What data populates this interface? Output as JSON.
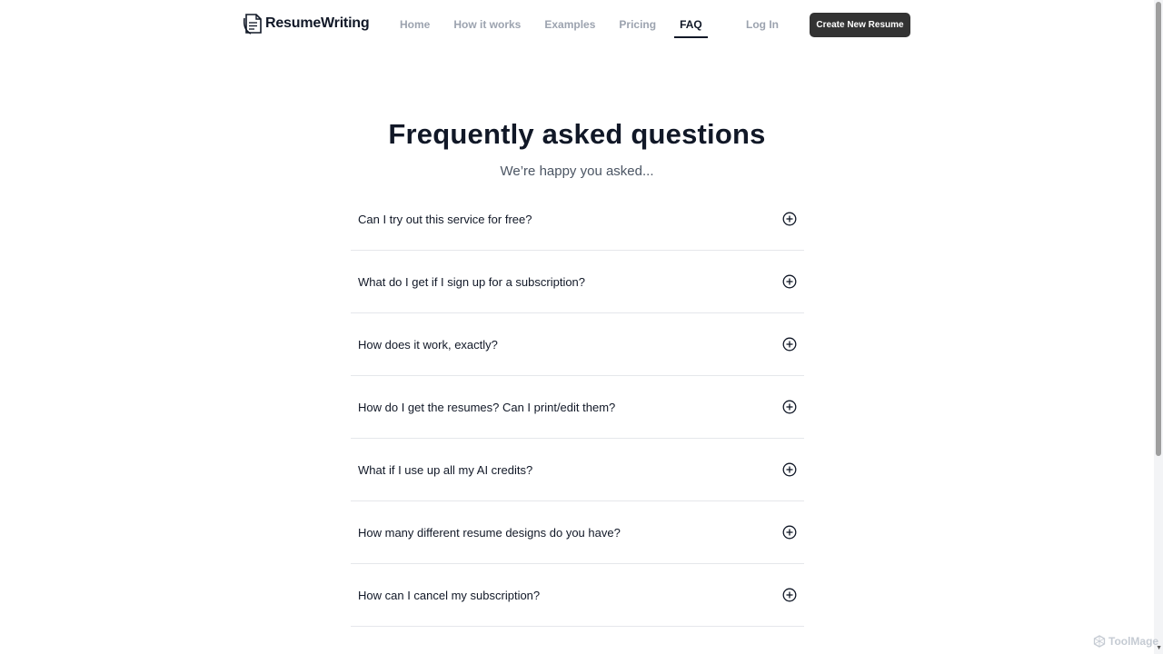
{
  "brand": {
    "name": "ResumeWriting",
    "icon": "resume-logo-icon"
  },
  "nav": {
    "items": [
      {
        "label": "Home",
        "active": false
      },
      {
        "label": "How it works",
        "active": false
      },
      {
        "label": "Examples",
        "active": false
      },
      {
        "label": "Pricing",
        "active": false
      },
      {
        "label": "FAQ",
        "active": true
      }
    ],
    "login_label": "Log In",
    "cta_label": "Create New Resume"
  },
  "hero": {
    "title": "Frequently asked questions",
    "subtitle": "We’re happy you asked..."
  },
  "faq": {
    "expand_icon": "plus-circle-icon",
    "items": [
      {
        "question": "Can I try out this service for free?"
      },
      {
        "question": "What do I get if I sign up for a subscription?"
      },
      {
        "question": "How does it work, exactly?"
      },
      {
        "question": "How do I get the resumes? Can I print/edit them?"
      },
      {
        "question": "What if I use up all my AI credits?"
      },
      {
        "question": "How many different resume designs do you have?"
      },
      {
        "question": "How can I cancel my subscription?"
      }
    ]
  },
  "watermark": {
    "text": "ToolMage"
  },
  "colors": {
    "cta_bg": "#333333",
    "nav_inactive": "#9ca3af",
    "nav_active": "#111827",
    "divider": "#e5e7eb"
  }
}
